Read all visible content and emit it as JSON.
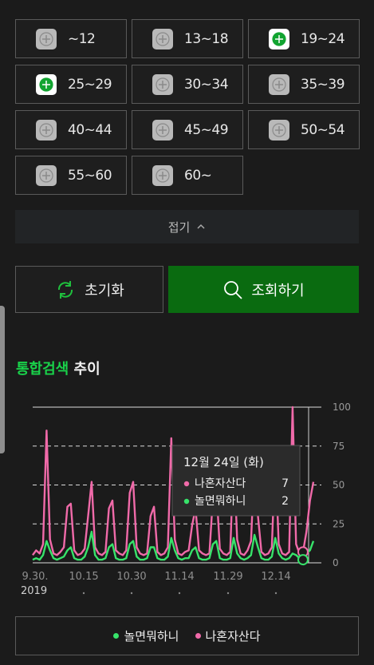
{
  "age_grid": {
    "items": [
      {
        "label": "~12",
        "selected": false
      },
      {
        "label": "13~18",
        "selected": false
      },
      {
        "label": "19~24",
        "selected": true
      },
      {
        "label": "25~29",
        "selected": true
      },
      {
        "label": "30~34",
        "selected": false
      },
      {
        "label": "35~39",
        "selected": false
      },
      {
        "label": "40~44",
        "selected": false
      },
      {
        "label": "45~49",
        "selected": false
      },
      {
        "label": "50~54",
        "selected": false
      },
      {
        "label": "55~60",
        "selected": false
      },
      {
        "label": "60~",
        "selected": false
      }
    ]
  },
  "fold": {
    "label": "접기"
  },
  "actions": {
    "reset_label": "초기화",
    "search_label": "조회하기"
  },
  "section": {
    "title_green": "통합검색",
    "title_white": "추이"
  },
  "colors": {
    "accent": "#0a6b10",
    "green_series": "#37e36a",
    "pink_series": "#f06aa9",
    "title_green": "#19d24a"
  },
  "chart_data": {
    "type": "line",
    "y_ticks": [
      "0",
      "25",
      "50",
      "75",
      "100"
    ],
    "ylim": [
      0,
      100
    ],
    "x_tick_labels": [
      "9.30.",
      "10.15",
      "10.30",
      "11.14",
      "11.29",
      "12.14"
    ],
    "x_year_label": "2019",
    "legend_placement": "bottom",
    "series": [
      {
        "name": "나혼자산다",
        "color": "#f06aa9",
        "values": [
          5,
          8,
          6,
          12,
          85,
          15,
          6,
          5,
          7,
          10,
          36,
          38,
          8,
          5,
          6,
          9,
          30,
          52,
          10,
          6,
          5,
          7,
          35,
          40,
          8,
          6,
          5,
          8,
          45,
          52,
          10,
          6,
          5,
          6,
          30,
          36,
          7,
          5,
          6,
          10,
          80,
          15,
          6,
          5,
          7,
          8,
          24,
          35,
          8,
          6,
          5,
          6,
          42,
          48,
          9,
          6,
          5,
          7,
          70,
          15,
          6,
          5,
          8,
          14,
          65,
          30,
          7,
          5,
          6,
          10,
          70,
          12,
          6,
          5,
          7,
          100,
          12,
          6,
          7,
          20,
          40,
          52
        ]
      },
      {
        "name": "놀면뭐하니",
        "color": "#37e36a",
        "values": [
          2,
          3,
          2,
          5,
          14,
          8,
          3,
          2,
          3,
          4,
          8,
          10,
          3,
          2,
          2,
          4,
          10,
          20,
          5,
          2,
          2,
          3,
          10,
          12,
          3,
          2,
          2,
          3,
          12,
          14,
          4,
          2,
          2,
          3,
          10,
          10,
          3,
          2,
          2,
          4,
          16,
          8,
          3,
          2,
          3,
          3,
          8,
          10,
          3,
          2,
          2,
          3,
          12,
          14,
          3,
          2,
          2,
          3,
          16,
          6,
          3,
          2,
          3,
          5,
          18,
          10,
          3,
          2,
          2,
          4,
          16,
          6,
          3,
          2,
          3,
          6,
          5,
          3,
          2,
          6,
          8,
          14
        ]
      }
    ],
    "tooltip": {
      "date": "12월 24일 (화)",
      "rows": [
        {
          "name": "나혼자산다",
          "value": "7",
          "color": "#f06aa9"
        },
        {
          "name": "놀면뭐하니",
          "value": "2",
          "color": "#37e36a"
        }
      ],
      "index": 78
    }
  }
}
